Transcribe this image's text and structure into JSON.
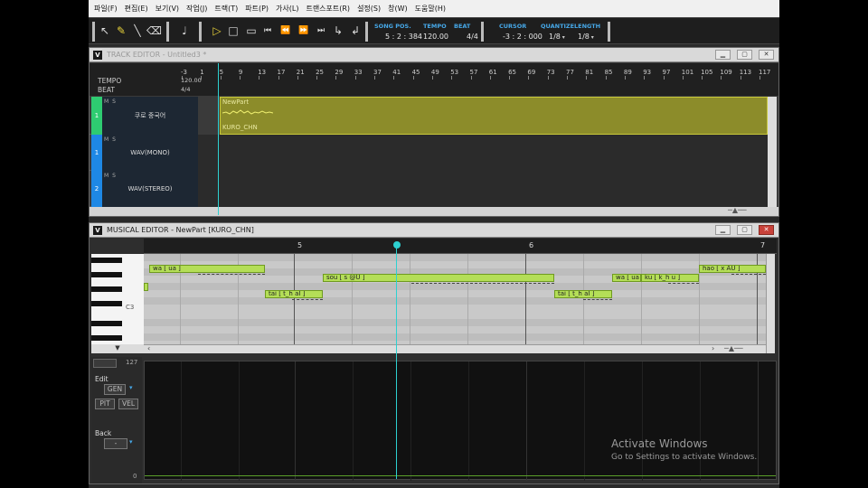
{
  "menu": [
    "파일(F)",
    "편집(E)",
    "보기(V)",
    "작업(J)",
    "트랙(T)",
    "파트(P)",
    "가사(L)",
    "트랜스포트(R)",
    "설정(S)",
    "창(W)",
    "도움말(H)"
  ],
  "toolbar": {
    "song_pos_label": "SONG POS.",
    "song_pos_value": "5 : 2 : 384",
    "tempo_label": "TEMPO",
    "tempo_value": "120.00",
    "beat_label": "BEAT",
    "beat_value": "4/4",
    "cursor_label": "CURSOR",
    "cursor_value": "-3 : 2 : 000",
    "quantize_label": "QUANTIZE",
    "quantize_value": "1/8",
    "length_label": "LENGTH",
    "length_value": "1/8"
  },
  "track_editor": {
    "title": "TRACK EDITOR - Untitled3 *",
    "ruler": [
      "-3",
      "1",
      "5",
      "9",
      "13",
      "17",
      "21",
      "25",
      "29",
      "33",
      "37",
      "41",
      "45",
      "49",
      "53",
      "57",
      "61",
      "65",
      "69",
      "73",
      "77",
      "81",
      "85",
      "89",
      "93",
      "97",
      "101",
      "105",
      "109",
      "113",
      "117"
    ],
    "tempo_label": "TEMPO",
    "tempo_value": "120.00",
    "beat_label": "BEAT",
    "beat_value": "4/4",
    "tracks": [
      {
        "num": "1",
        "ms": "M S",
        "name": "쿠로 중국어",
        "color": "#2ecc71"
      },
      {
        "num": "1",
        "ms": "M S",
        "name": "WAV(MONO)",
        "color": "#1e88e5"
      },
      {
        "num": "2",
        "ms": "M S",
        "name": "WAV(STEREO)",
        "color": "#1e88e5"
      }
    ],
    "part": {
      "name": "NewPart",
      "singer": "KURO_CHN"
    }
  },
  "musical_editor": {
    "title": "MUSICAL EDITOR - NewPart [KURO_CHN]",
    "bars": [
      "5",
      "6",
      "7"
    ],
    "piano_label": "C3",
    "notes": [
      {
        "lyric": "wa [ ua ]"
      },
      {
        "lyric": "tai [ t_h aI ]"
      },
      {
        "lyric": "sou [ s @U ]"
      },
      {
        "lyric": "tai [ t_h aI ]"
      },
      {
        "lyric": "wa [ ua ]"
      },
      {
        "lyric": "ku [ k_h u ]"
      },
      {
        "lyric": "hao [ x AU ]"
      }
    ],
    "ctrl": {
      "max": "127",
      "min": "0",
      "edit_label": "Edit",
      "gen": "GEN",
      "pit": "PIT",
      "vel": "VEL",
      "back_label": "Back",
      "back_value": "-"
    }
  },
  "watermark": {
    "line1": "Activate Windows",
    "line2": "Go to Settings to activate Windows."
  },
  "colors": {
    "accent": "#46a8e8",
    "note": "#b4de57",
    "part": "#8c8c2a",
    "cursor": "#2dd1d1"
  }
}
